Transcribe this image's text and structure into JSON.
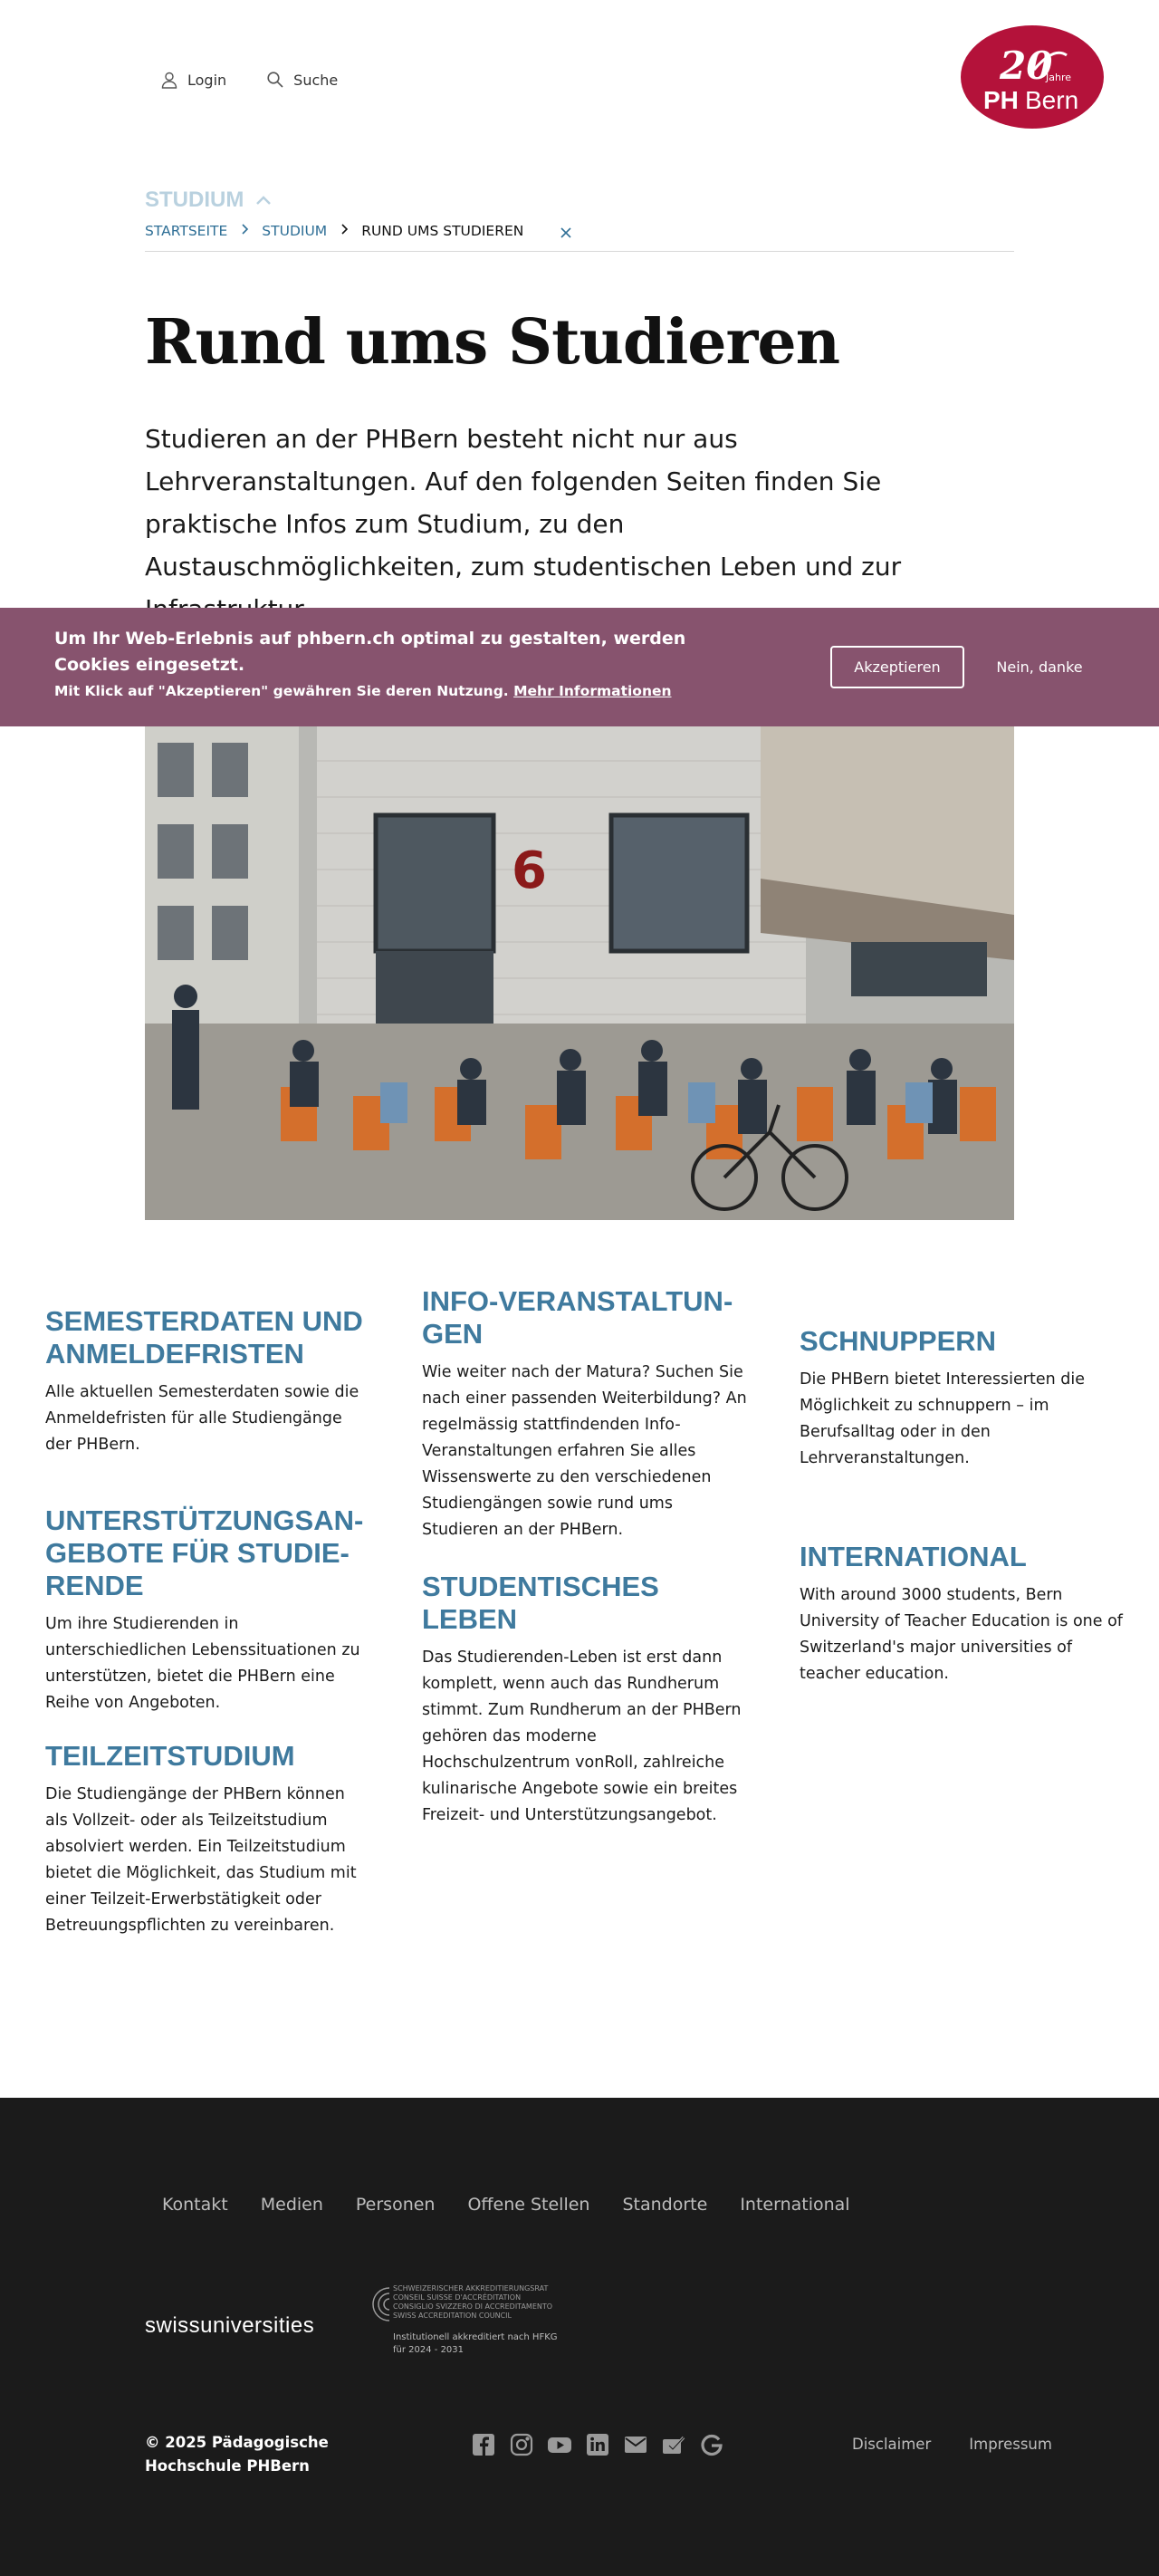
{
  "header": {
    "login_label": "Login",
    "search_label": "Suche",
    "logo_number": "20",
    "logo_jahre": "Jahre",
    "logo_ph": "PH",
    "logo_bern": "Bern"
  },
  "section": {
    "label": "STUDIUM"
  },
  "breadcrumb": {
    "home": "STARTSEITE",
    "studium": "STUDIUM",
    "current": "RUND UMS STUDIEREN"
  },
  "hero": {
    "title": "Rund ums Studieren",
    "lead": "Studieren an der PHBern besteht nicht nur aus Lehrveranstaltungen. Auf den folgenden Seiten finden Sie praktische Infos zum Studium, zu den Austauschmöglichkeiten, zum studentischen Leben und zur Infrastruktur.",
    "photo_number": "6"
  },
  "cookie": {
    "text": "Um Ihr Web-Erlebnis auf phbern.ch optimal zu gestalten, werden Cookies eingesetzt.",
    "sub": "Mit Klick auf \"Akzeptieren\" gewähren Sie deren Nutzung.",
    "more_link": "Mehr Informationen",
    "accept": "Akzeptieren",
    "decline": "Nein, danke"
  },
  "teasers": [
    {
      "title": "SEMESTERDATEN UND ANMELDEFRISTEN",
      "text": "Alle aktuellen Semesterdaten sowie die Anmeldefristen für alle Studiengänge der PHBern."
    },
    {
      "title": "UNTERSTÜTZUNGSAN­GEBOTE FÜR STUDIE­RENDE",
      "text": "Um ihre Studierenden in unterschiedlichen Lebenssituationen zu unterstützen, bietet die PHBern eine Reihe von Angeboten."
    },
    {
      "title": "TEILZEITSTUDIUM",
      "text": "Die Studiengänge der PHBern können als Vollzeit- oder als Teilzeitstudium absolviert werden. Ein Teilzeitstudium bietet die Möglichkeit, das Studium mit einer Teilzeit-Erwerbstätigkeit oder Betreuungspflichten zu vereinbaren."
    },
    {
      "title": "INFO-VERANSTALTUN­GEN",
      "text": "Wie weiter nach der Matura? Suchen Sie nach einer passenden Weiterbildung? An regelmässig stattfindenden Info-Veranstaltungen erfahren Sie alles Wissenswerte zu den verschiedenen Studiengängen sowie rund ums Studieren an der PHBern."
    },
    {
      "title": "STUDENTISCHES LEBEN",
      "text": "Das Studierenden-Leben ist erst dann komplett, wenn auch das Rundherum stimmt. Zum Rundherum an der PHBern gehören das moderne Hochschulzentrum vonRoll, zahlreiche kulinarische Angebote sowie ein breites Freizeit- und Unterstützungsangebot."
    },
    {
      "title": "SCHNUPPERN",
      "text": "Die PHBern bietet Interessierten die Möglichkeit zu schnuppern – im Berufsalltag oder in den Lehrveranstaltungen."
    },
    {
      "title": "INTERNATIONAL",
      "text": "With around 3000 students, Bern University of Teacher Education is one of Switzerland's major universities of teacher education."
    }
  ],
  "footer": {
    "nav": [
      "Kontakt",
      "Medien",
      "Personen",
      "Offene Stellen",
      "Standorte",
      "International"
    ],
    "swissuniversities": "swissuniversities",
    "accreditation_lines": [
      "Schweizerischer Akkreditierungsrat",
      "Conseil suisse d'accréditation",
      "Consiglio svizzero di accreditamento",
      "Swiss Accreditation Council"
    ],
    "accreditation_note": "Institutionell akkreditiert nach HFKG für 2024 - 2031",
    "copyright": "© 2025 Pädagogische Hochschule PHBern",
    "social_icons": [
      "facebook-icon",
      "instagram-icon",
      "youtube-icon",
      "linkedin-icon",
      "mail-icon",
      "checklist-icon",
      "google-icon"
    ],
    "disclaimer": "Disclaimer",
    "impressum": "Impressum"
  },
  "colors": {
    "brand_red": "#b4123a",
    "accent_blue": "#3f7a9e",
    "cookie_bg": "#87536e",
    "footer_bg": "#1b1b1b"
  }
}
